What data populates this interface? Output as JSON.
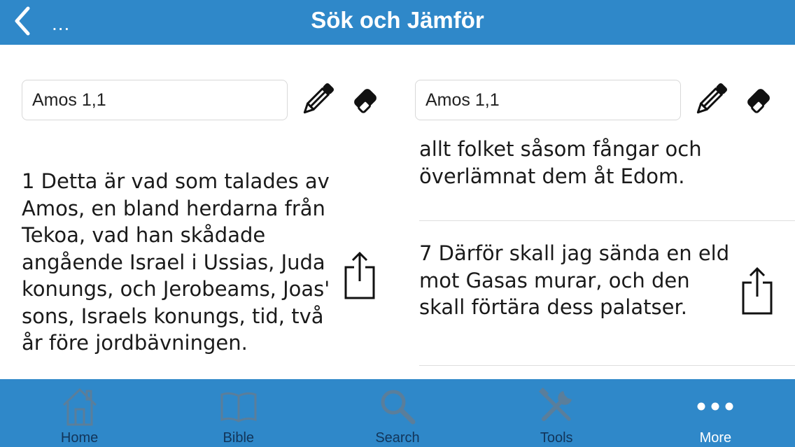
{
  "header": {
    "back_dots": "...",
    "title": "Sök och Jämför"
  },
  "left_column": {
    "reference": "Amos 1,1",
    "verse_text": "1  Detta är vad som talades av Amos, en bland herdarna från Tekoa, vad han skådade angående Israel i Ussias, Juda konungs, och Jerobeams, Joas' sons, Israels konungs, tid, två år före jordbävningen."
  },
  "right_column": {
    "reference": "Amos 1,1",
    "verse_prev_text": "allt folket såsom fångar och överlämnat dem åt Edom.",
    "verse_text": "7  Därför skall jag sända en eld mot Gasas murar, och den skall förtära dess palatser."
  },
  "tabs": [
    {
      "label": "Home",
      "icon": "home-icon",
      "active": false
    },
    {
      "label": "Bible",
      "icon": "book-icon",
      "active": false
    },
    {
      "label": "Search",
      "icon": "search-icon",
      "active": false
    },
    {
      "label": "Tools",
      "icon": "tools-icon",
      "active": false
    },
    {
      "label": "More",
      "icon": "more-icon",
      "active": true
    }
  ],
  "colors": {
    "header_bg": "#2f88c9",
    "tab_inactive": "#12355a",
    "tab_icon_inactive": "#5a7e9b",
    "tab_active": "#ffffff"
  }
}
